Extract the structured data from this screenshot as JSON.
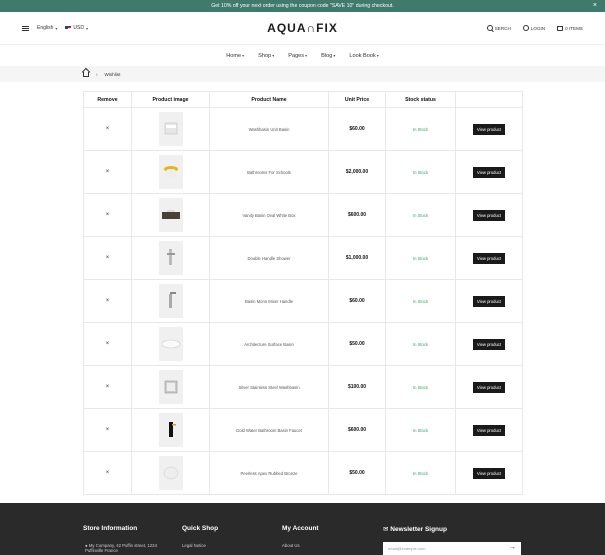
{
  "promo": {
    "text": "Get 10% off your next order using the coupon code \"SAVE 10\" during checkout.",
    "close": "×"
  },
  "header": {
    "language": "English",
    "currency": "USD",
    "logo": "AQUA∩FIX",
    "search_label": "SERCH",
    "login_label": "LOGIN",
    "cart_label": "0 ITEMS"
  },
  "nav": {
    "items": [
      {
        "label": "Home"
      },
      {
        "label": "Shop"
      },
      {
        "label": "Pages"
      },
      {
        "label": "Blog"
      },
      {
        "label": "Look Book"
      }
    ]
  },
  "breadcrumb": {
    "current": "Wishlist"
  },
  "table": {
    "headers": [
      "Remove",
      "Product image",
      "Product Name",
      "Unit Price",
      "Stock status",
      ""
    ],
    "rows": [
      {
        "name": "Washbasin Unit Basin",
        "price": "$60.00",
        "stock": "In Stock",
        "action": "View product"
      },
      {
        "name": "Bathrooms For Schools",
        "price": "$2,000.00",
        "stock": "In Stock",
        "action": "View product"
      },
      {
        "name": "Vanity Basin Oval White Box",
        "price": "$600.00",
        "stock": "In Stock",
        "action": "View product"
      },
      {
        "name": "Double Handle Shower",
        "price": "$1,000.00",
        "stock": "In Stock",
        "action": "View product"
      },
      {
        "name": "Basin Mono Mixer Handle",
        "price": "$60.00",
        "stock": "In Stock",
        "action": "View product"
      },
      {
        "name": "Architecture Surface Basin",
        "price": "$50.00",
        "stock": "In Stock",
        "action": "View product"
      },
      {
        "name": "Silver Stainless Steel Washbasin",
        "price": "$100.00",
        "stock": "In Stock",
        "action": "View product"
      },
      {
        "name": "Gold Water Bathroom Basin Faucet",
        "price": "$600.00",
        "stock": "In Stock",
        "action": "View product"
      },
      {
        "name": "Peerless Apex Rubbed Bronze",
        "price": "$50.00",
        "stock": "In Stock",
        "action": "View product"
      }
    ]
  },
  "footer": {
    "store_info": "Store Information",
    "quick_shop": "Quick Shop",
    "my_account": "My Account",
    "newsletter": "Newsletter Signup",
    "address": "My Company, 42 Puffin street, 1234 Puffinville France",
    "quick_link": "Legal Notice",
    "account_link": "About Us",
    "email_placeholder": "email@example.com"
  },
  "colors": {
    "promo_bg": "#3f7a6c",
    "stock_green": "#3aa35c",
    "footer_bg": "#2a2a2a",
    "button_bg": "#1a1a1a"
  }
}
